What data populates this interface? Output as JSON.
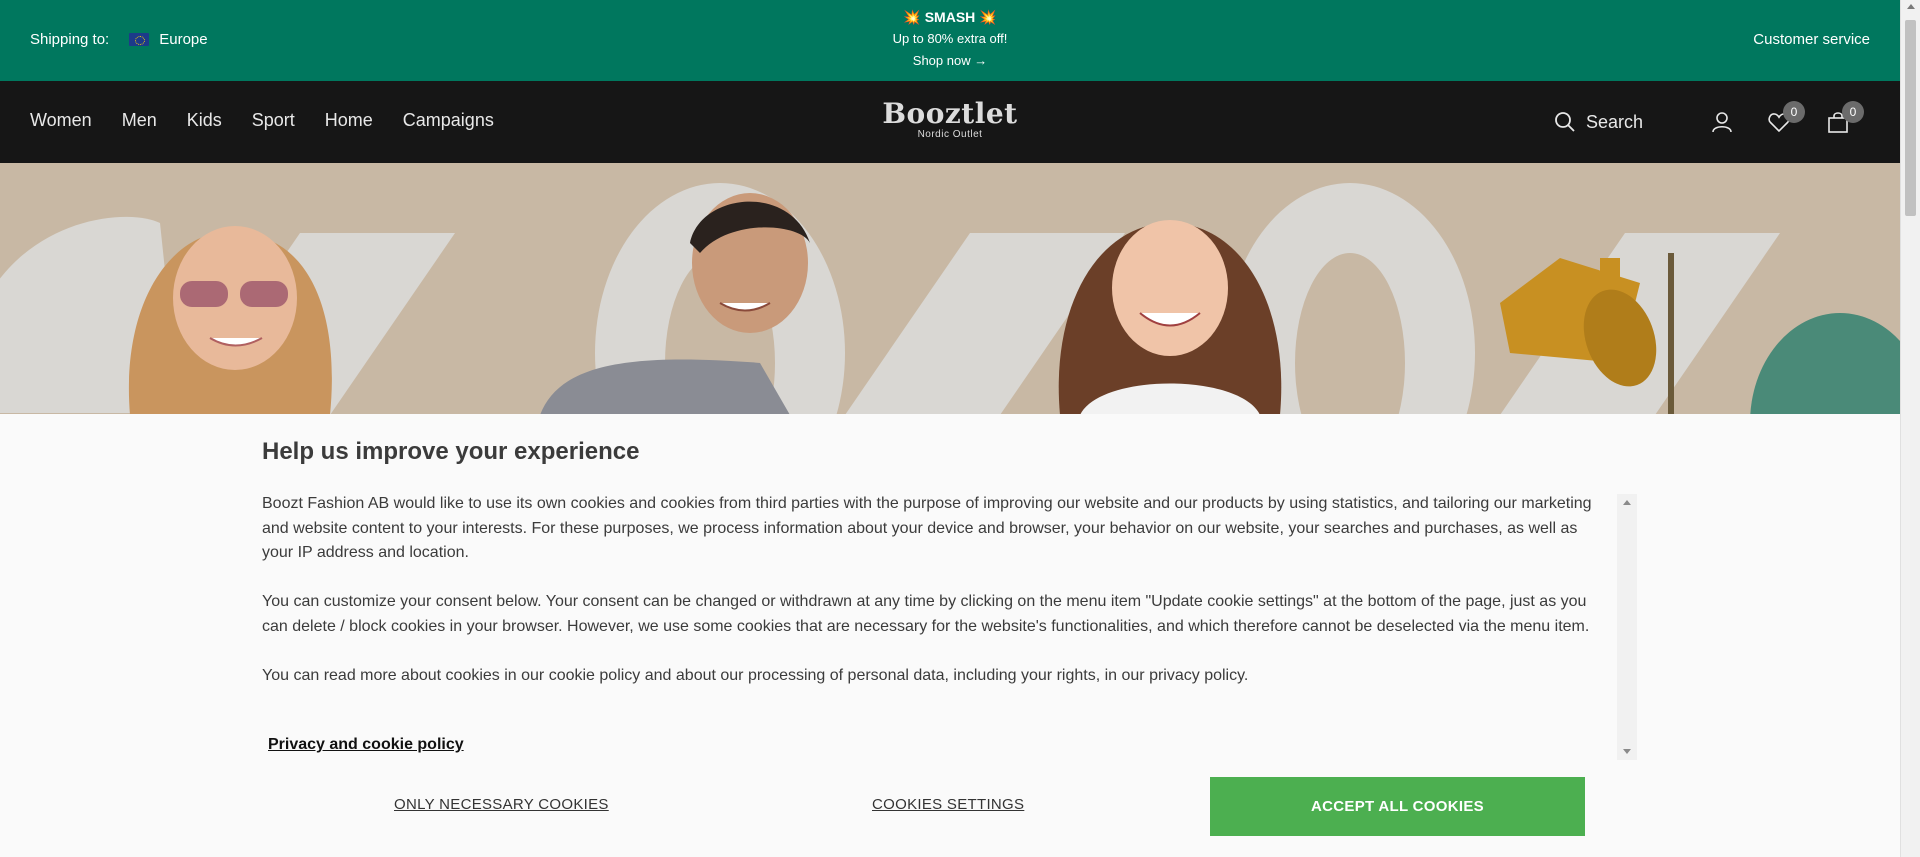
{
  "promo": {
    "shipping_label": "Shipping to:",
    "region": "Europe",
    "smash": "💥 SMASH 💥",
    "offer": "Up to 80% extra off!",
    "cta": "Shop now →",
    "customer_service": "Customer service",
    "background_color": "#00775e"
  },
  "nav": {
    "links": [
      "Women",
      "Men",
      "Kids",
      "Sport",
      "Home",
      "Campaigns"
    ],
    "logo_brand": "Booztlet",
    "logo_sub": "Nordic Outlet",
    "search_label": "Search",
    "wishlist_count": "0",
    "cart_count": "0",
    "icons": {
      "search": "search-icon",
      "account": "user-icon",
      "wishlist": "heart-icon",
      "cart": "bag-icon"
    }
  },
  "hero": {
    "background_color": "#c8b8a4"
  },
  "cookie": {
    "title": "Help us improve your experience",
    "paragraphs": [
      "Boozt Fashion AB would like to use its own cookies and cookies from third parties with the purpose of improving our website and our products by using statistics, and tailoring our marketing and website content to your interests. For these purposes, we process information about your device and browser, your behavior on our website, your searches and purchases, as well as your IP address and location.",
      "You can customize your consent below. Your consent can be changed or withdrawn at any time by clicking on the menu item \"Update cookie settings\" at the bottom of the page, just as you can delete / block cookies in your browser. However, we use some cookies that are necessary for the website's functionalities, and which therefore cannot be deselected via the menu item.",
      "You can read more about cookies in our cookie policy and about our processing of personal data, including your rights, in our privacy policy."
    ],
    "policy_link": "Privacy and cookie policy",
    "only_necessary": "ONLY NECESSARY COOKIES",
    "settings": "COOKIES SETTINGS",
    "accept_all": "ACCEPT ALL COOKIES",
    "accept_color": "#4caf50"
  }
}
